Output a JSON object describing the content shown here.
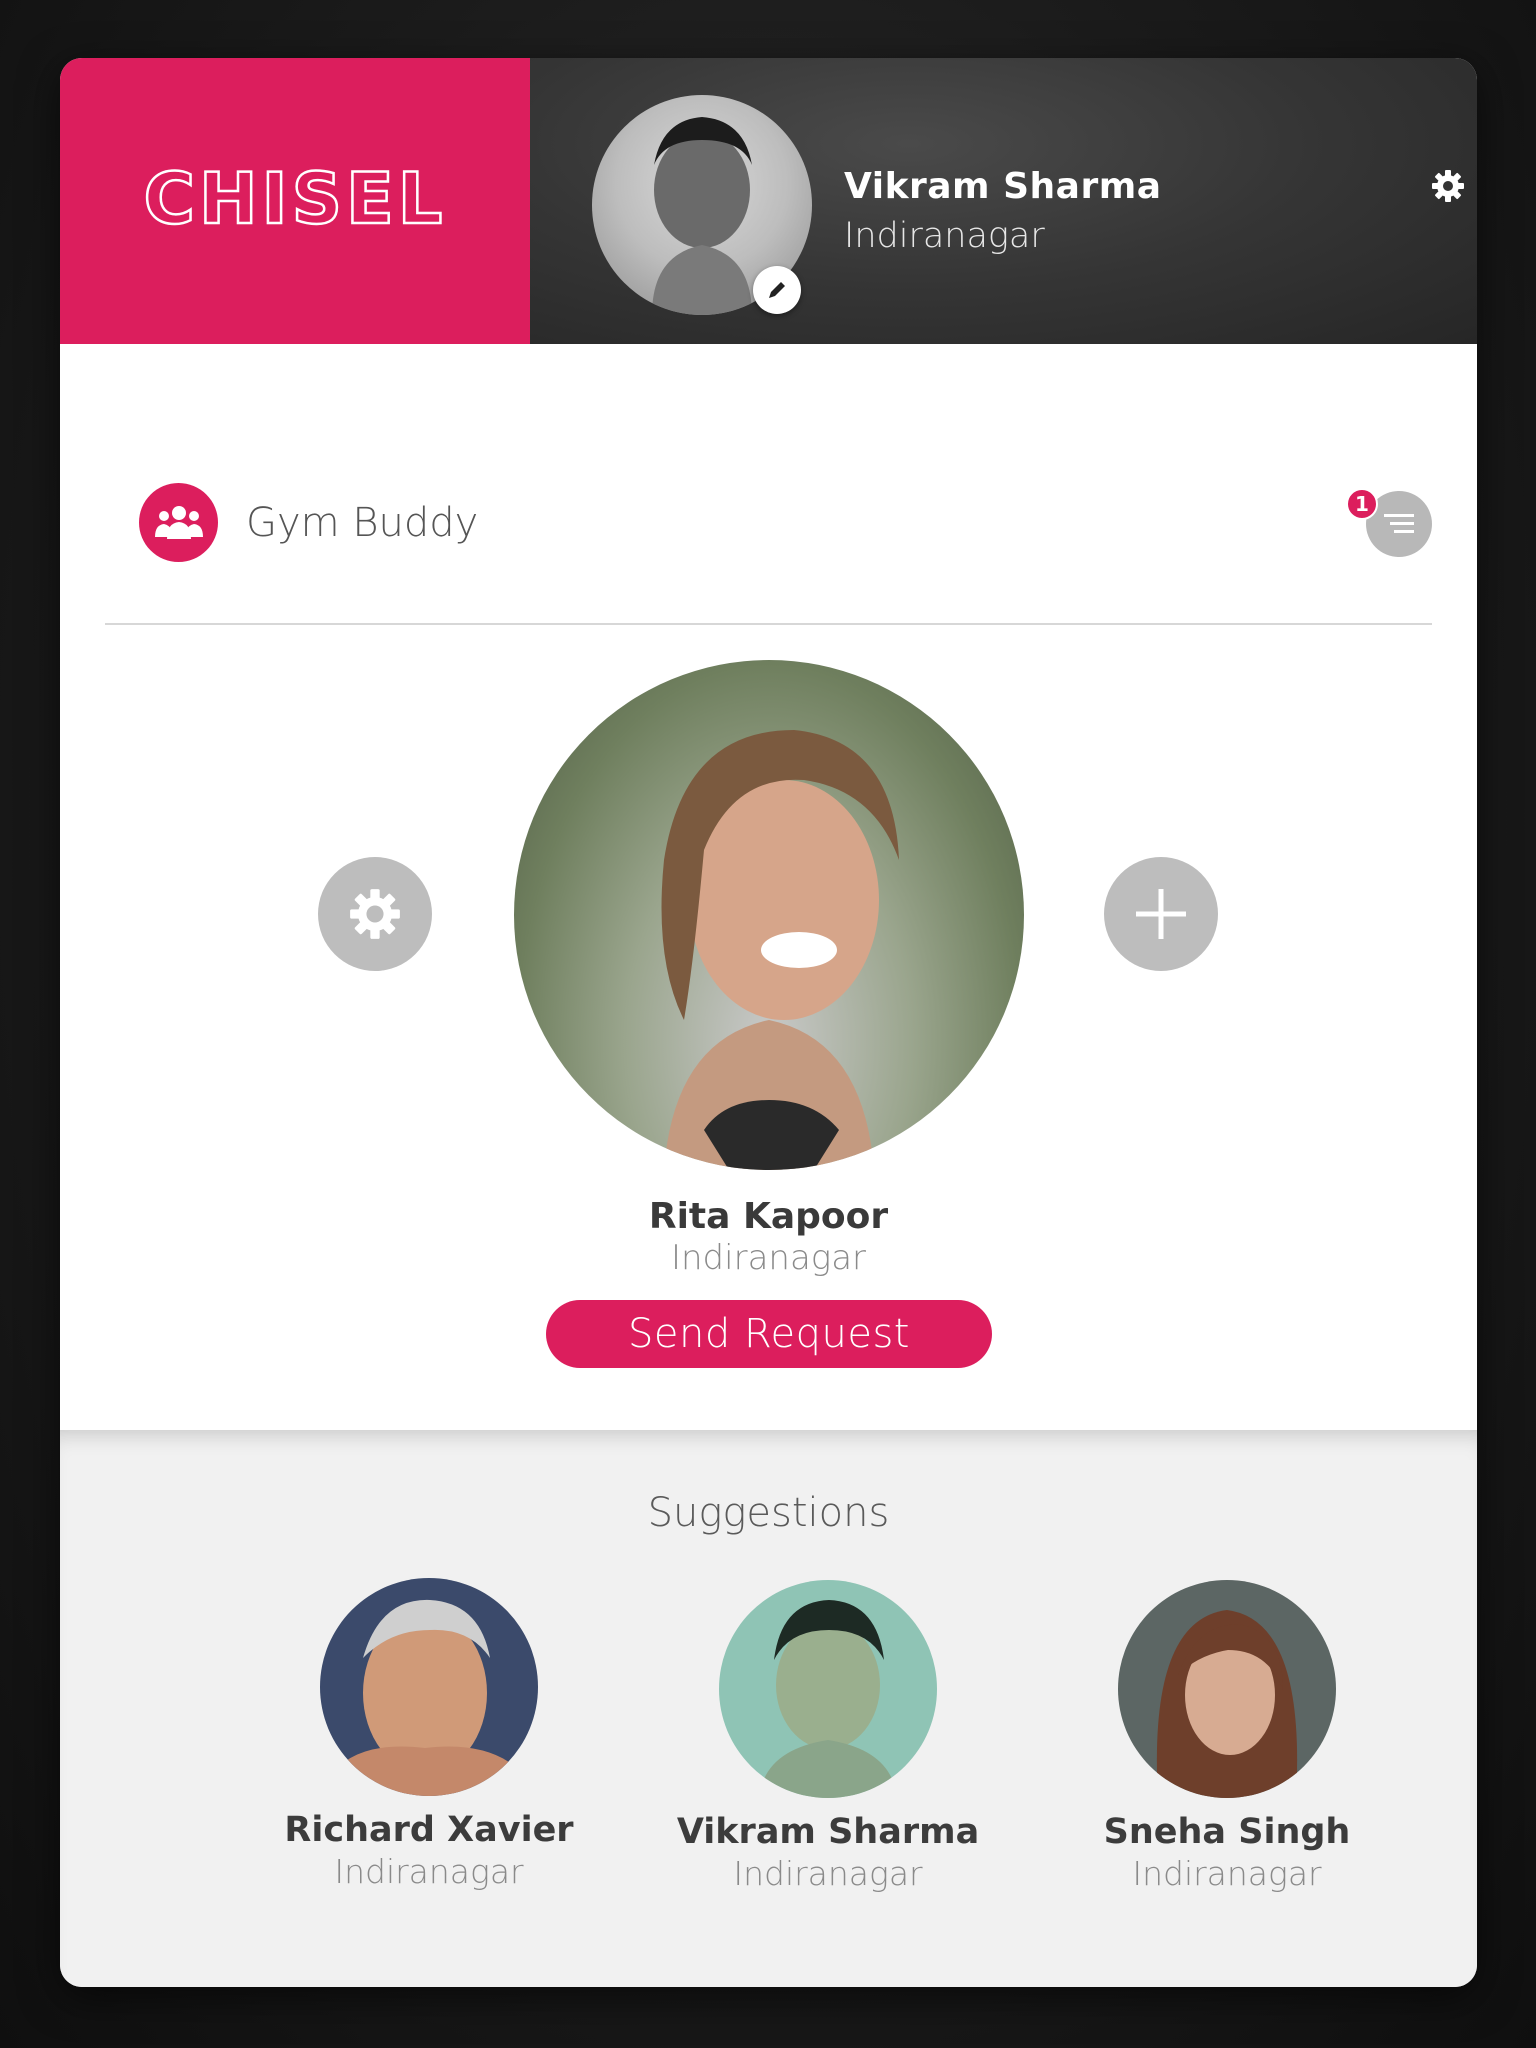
{
  "brand": {
    "logo_text": "CHISEL",
    "color": "#dc1e5d"
  },
  "current_user": {
    "name": "Vikram Sharma",
    "location": "Indiranagar"
  },
  "section": {
    "title": "Gym Buddy",
    "icon": "group-icon",
    "notification_count": "1"
  },
  "featured": {
    "name": "Rita Kapoor",
    "location": "Indiranagar",
    "action_label": "Send Request"
  },
  "suggestions": {
    "title": "Suggestions",
    "people": [
      {
        "name": "Richard Xavier",
        "location": "Indiranagar"
      },
      {
        "name": "Vikram Sharma",
        "location": "Indiranagar"
      },
      {
        "name": "Sneha Singh",
        "location": "Indiranagar"
      }
    ]
  },
  "icons": {
    "settings": "gear-icon",
    "edit": "pencil-icon",
    "menu": "list-icon",
    "filter": "gear-icon",
    "add": "plus-icon"
  }
}
